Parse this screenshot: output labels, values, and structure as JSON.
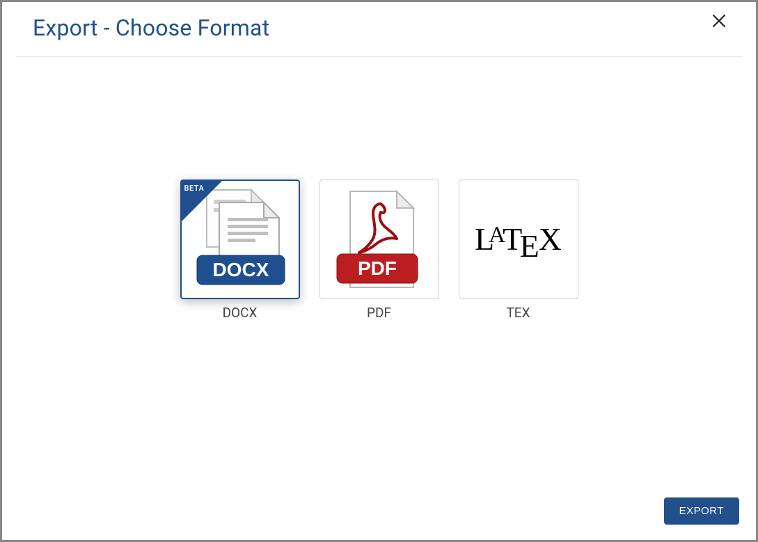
{
  "dialog": {
    "title": "Export - Choose Format",
    "close_aria": "Close"
  },
  "formats": [
    {
      "id": "docx",
      "label": "DOCX",
      "selected": true,
      "badge": "BETA",
      "badge_text": "DOCX"
    },
    {
      "id": "pdf",
      "label": "PDF",
      "selected": false,
      "badge": null,
      "badge_text": "PDF"
    },
    {
      "id": "tex",
      "label": "TEX",
      "selected": false,
      "badge": null,
      "badge_text": null
    }
  ],
  "actions": {
    "export": "EXPORT"
  },
  "colors": {
    "accent": "#21508a",
    "pdf_red": "#bb1e21",
    "docx_blue": "#1f4f8f"
  }
}
